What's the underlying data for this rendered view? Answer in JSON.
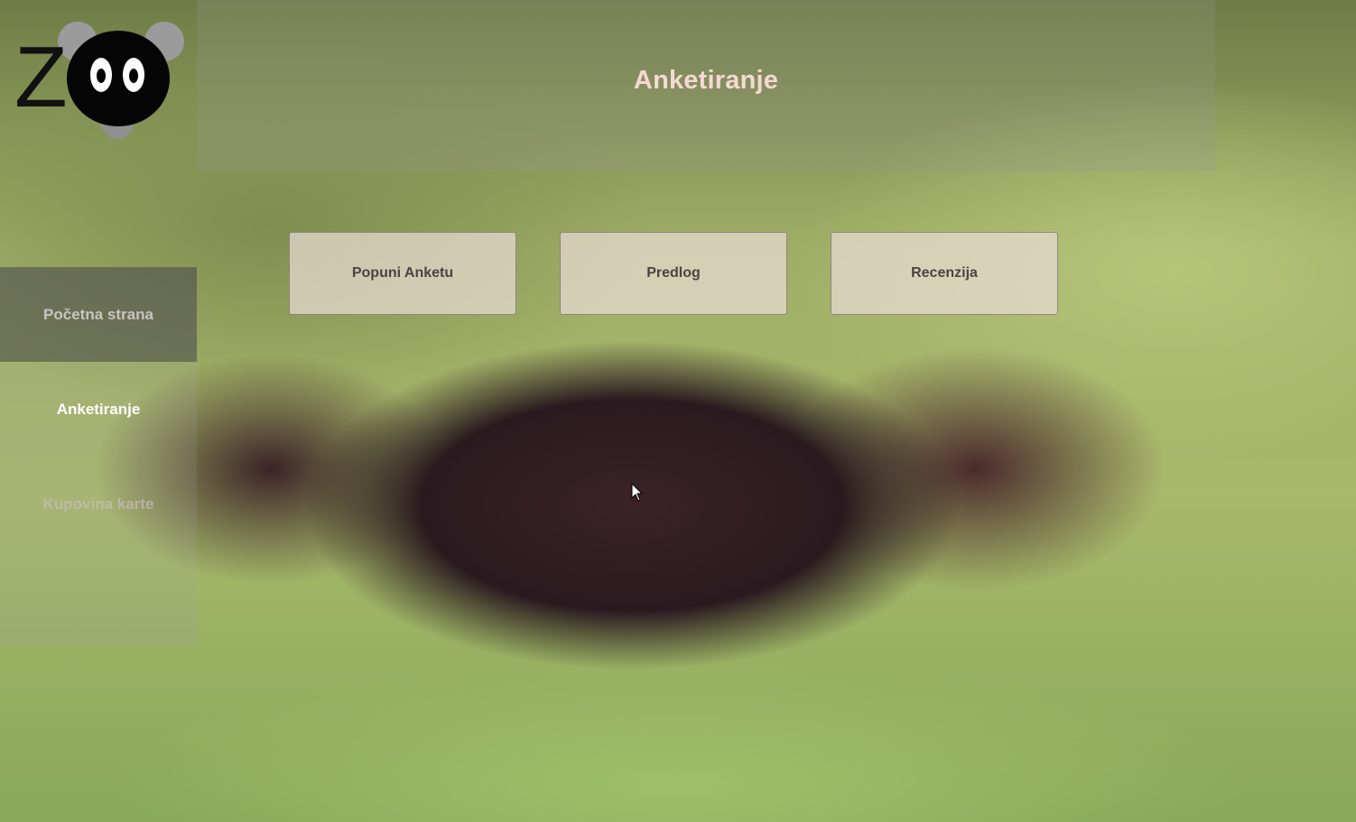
{
  "logo": {
    "text": "Z"
  },
  "header": {
    "title": "Anketiranje"
  },
  "sidebar": {
    "items": [
      {
        "label": "Početna strana"
      },
      {
        "label": "Anketiranje"
      },
      {
        "label": "Kupovina karte"
      }
    ]
  },
  "actions": {
    "buttons": [
      {
        "label": "Popuni Anketu"
      },
      {
        "label": "Predlog"
      },
      {
        "label": "Recenzija"
      }
    ]
  },
  "colors": {
    "title": "#f6d9d2",
    "button_bg": "#e8dcd4",
    "button_text": "#4a4440"
  }
}
